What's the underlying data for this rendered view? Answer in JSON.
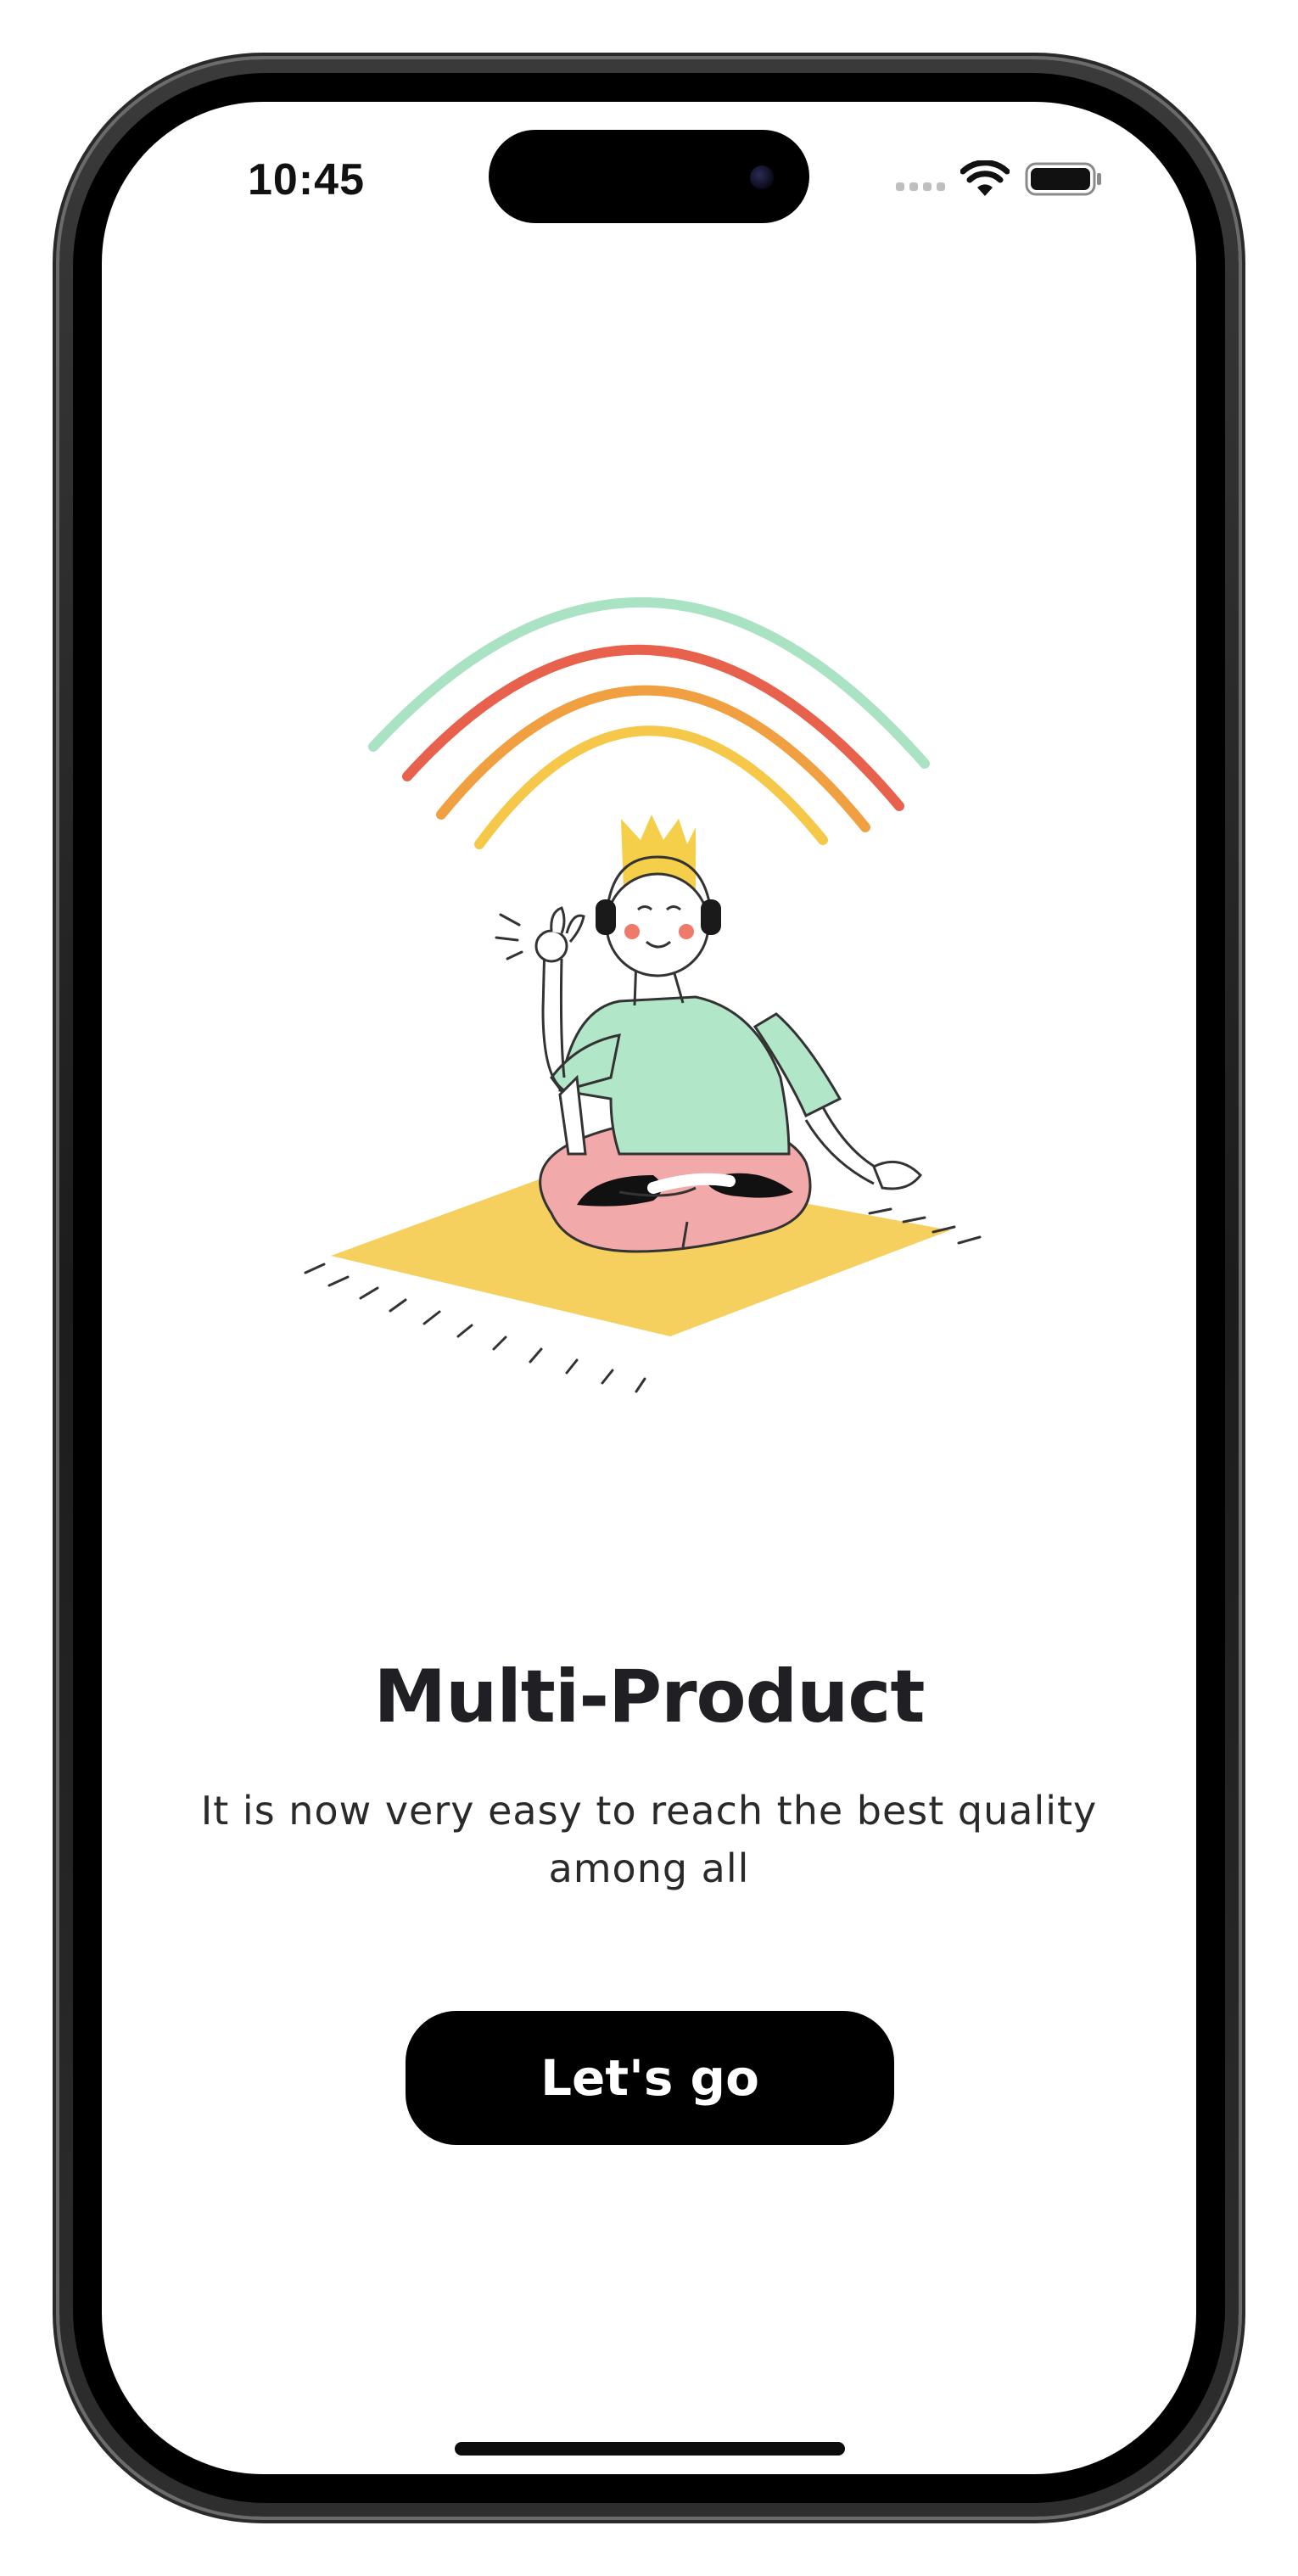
{
  "status_bar": {
    "time": "10:45"
  },
  "onboarding": {
    "illustration": "meditating-person-with-headphones-rainbow",
    "title": "Multi-Product",
    "subtitle": "It is now very easy to reach the best quality among all",
    "cta_label": "Let's go"
  },
  "colors": {
    "background": "#ffffff",
    "button": "#000000",
    "button_text": "#ffffff",
    "rainbow_outer": "#a9e3c4",
    "rainbow_red": "#e8614d",
    "rainbow_orange": "#f0a040",
    "rainbow_yellow": "#f5c84a",
    "shirt": "#b2e6c8",
    "pants": "#f2a9aa",
    "mat": "#f5d05e",
    "crown": "#f5cf4a"
  },
  "icons": {
    "wifi": "wifi-icon",
    "battery": "battery-icon",
    "signal": "cellular-signal-icon"
  }
}
